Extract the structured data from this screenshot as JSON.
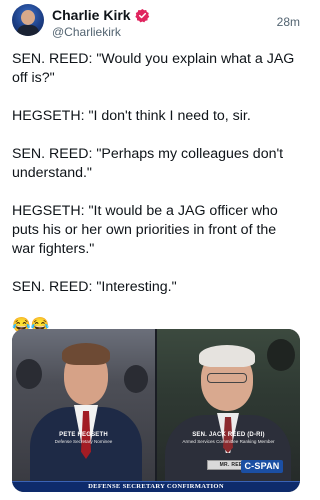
{
  "author": {
    "display_name": "Charlie Kirk",
    "handle": "@Charliekirk",
    "avatar_icon": "avatar-photo",
    "verified_icon": "verified-badge-icon",
    "verified_color": "#e0245e"
  },
  "post": {
    "timestamp": "28m",
    "paragraphs": [
      "SEN. REED: \"Would you explain what a JAG off is?\"",
      "HEGSETH: \"I don't think I need to, sir.",
      "SEN. REED: \"Perhaps my colleagues don't understand.\"",
      "HEGSETH: \"It would be a JAG officer who puts his or her own priorities in front of the war fighters.\"",
      "SEN. REED: \"Interesting.\""
    ],
    "emoji": "😂😂"
  },
  "media": {
    "left_panel": {
      "name": "PETE HEGSETH",
      "title": "Defense Secretary Nominee"
    },
    "right_panel": {
      "name": "SEN. JACK REED (D-RI)",
      "title": "Armed Services Committee Ranking Member",
      "nameplate": "MR. REED"
    },
    "network_logo": "C-SPAN",
    "caption": "DEFENSE SECRETARY CONFIRMATION"
  }
}
